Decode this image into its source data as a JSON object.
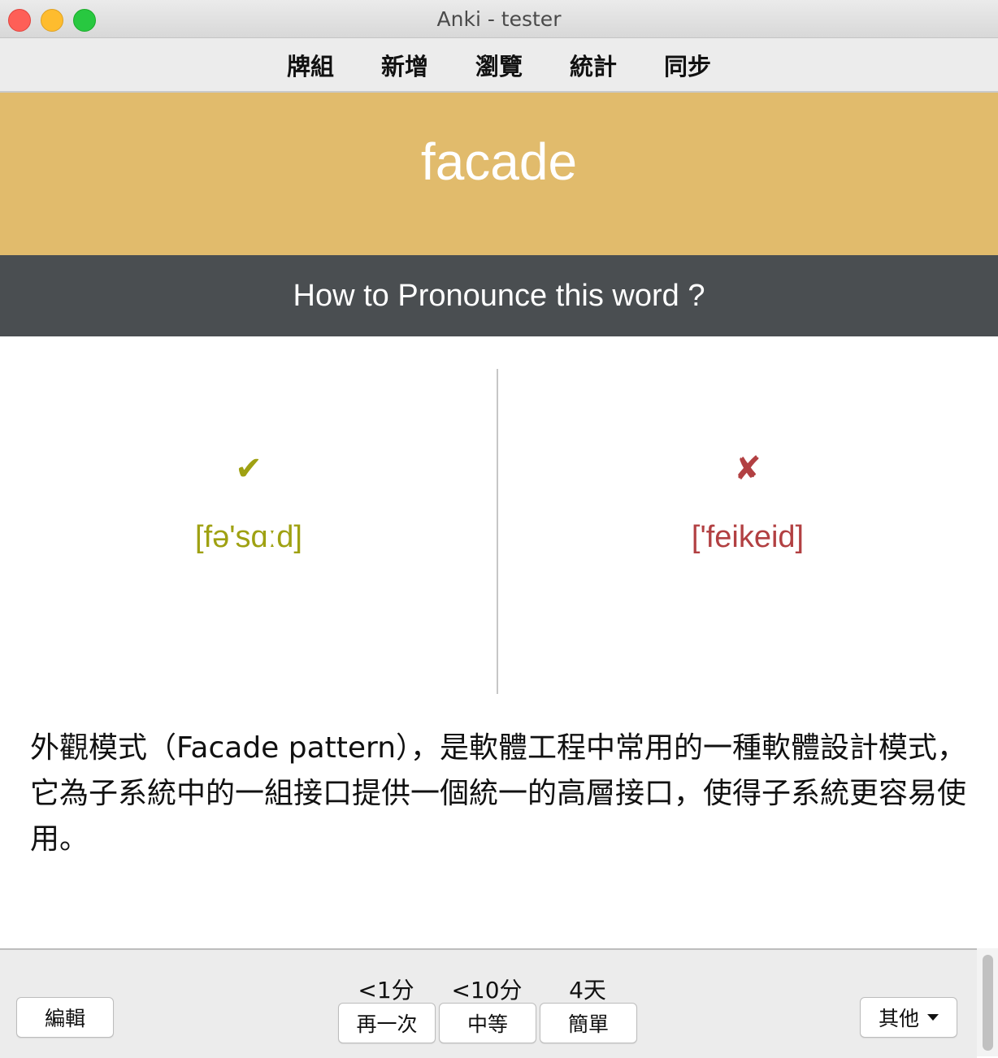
{
  "window": {
    "title": "Anki - tester"
  },
  "toolbar": {
    "items": [
      "牌組",
      "新增",
      "瀏覽",
      "統計",
      "同步"
    ]
  },
  "card": {
    "front_word": "facade",
    "question": "How to Pronounce this word ?",
    "correct": {
      "mark": "✔",
      "ipa": "[fə'sɑːd]",
      "color": "#9fa112"
    },
    "incorrect": {
      "mark": "✘",
      "ipa": "['feikeid]",
      "color": "#b24042"
    },
    "definition": "外觀模式（Facade pattern），是軟體工程中常用的一種軟體設計模式，它為子系統中的一組接口提供一個統一的高層接口，使得子系統更容易使用。",
    "front_bg": "#e1bb6c",
    "question_bg": "#4a4e51"
  },
  "bottom": {
    "edit_label": "編輯",
    "more_label": "其他",
    "answers": [
      {
        "time": "<1分",
        "label": "再一次"
      },
      {
        "time": "<10分",
        "label": "中等"
      },
      {
        "time": "4天",
        "label": "簡單"
      }
    ]
  }
}
